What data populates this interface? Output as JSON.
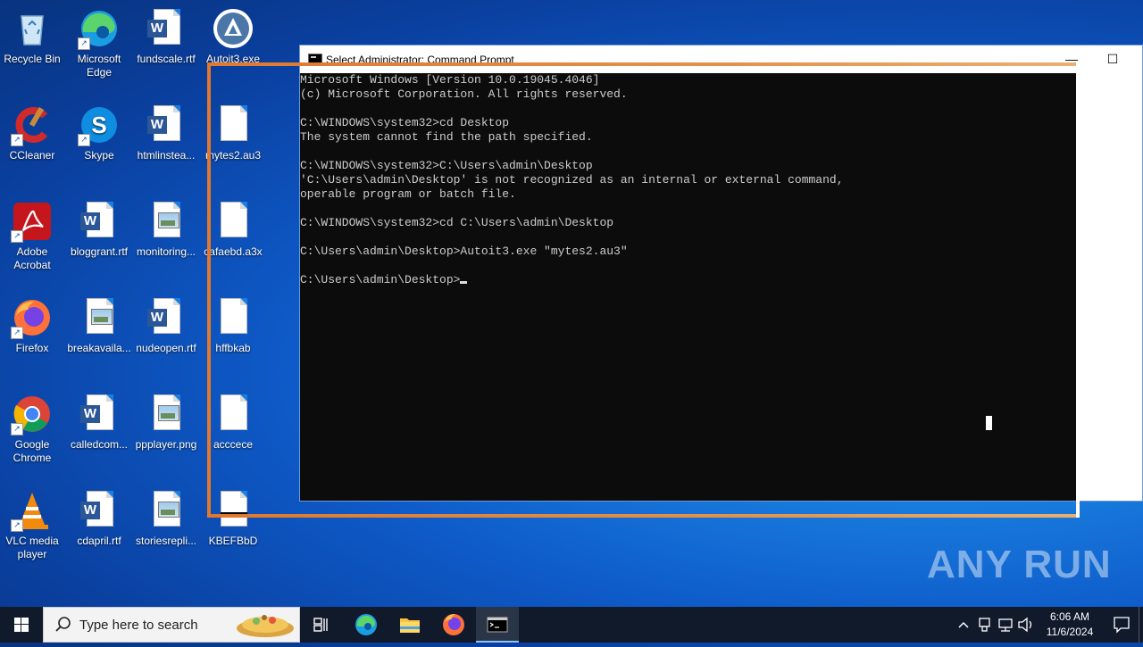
{
  "desktop": {
    "icons": [
      {
        "label": "Recycle Bin"
      },
      {
        "label": "Microsoft Edge"
      },
      {
        "label": "fundscale.rtf"
      },
      {
        "label": "Autoit3.exe"
      },
      {
        "label": "CCleaner"
      },
      {
        "label": "Skype"
      },
      {
        "label": "htmlinstea..."
      },
      {
        "label": "mytes2.au3"
      },
      {
        "label": "Adobe Acrobat"
      },
      {
        "label": "bloggrant.rtf"
      },
      {
        "label": "monitoring..."
      },
      {
        "label": "cafaebd.a3x"
      },
      {
        "label": "Firefox"
      },
      {
        "label": "breakavaila..."
      },
      {
        "label": "nudeopen.rtf"
      },
      {
        "label": "hffbkab"
      },
      {
        "label": "Google Chrome"
      },
      {
        "label": "calledcom..."
      },
      {
        "label": "ppplayer.png"
      },
      {
        "label": "acccece"
      },
      {
        "label": "VLC media player"
      },
      {
        "label": "cdapril.rtf"
      },
      {
        "label": "storiesrepli..."
      },
      {
        "label": "KBEFBbD"
      }
    ]
  },
  "window": {
    "title": "Select Administrator: Command Prompt",
    "minimize_glyph": "—",
    "maximize_glyph": "☐",
    "console_lines": [
      "Microsoft Windows [Version 10.0.19045.4046]",
      "(c) Microsoft Corporation. All rights reserved.",
      "",
      "C:\\WINDOWS\\system32>cd Desktop",
      "The system cannot find the path specified.",
      "",
      "C:\\WINDOWS\\system32>C:\\Users\\admin\\Desktop",
      "'C:\\Users\\admin\\Desktop' is not recognized as an internal or external command,",
      "operable program or batch file.",
      "",
      "C:\\WINDOWS\\system32>cd C:\\Users\\admin\\Desktop",
      "",
      "C:\\Users\\admin\\Desktop>Autoit3.exe \"mytes2.au3\"",
      "",
      "C:\\Users\\admin\\Desktop>"
    ]
  },
  "watermark": "ANY RUN",
  "taskbar": {
    "search_placeholder": "Type here to search",
    "time": "6:06 AM",
    "date": "11/6/2024"
  }
}
